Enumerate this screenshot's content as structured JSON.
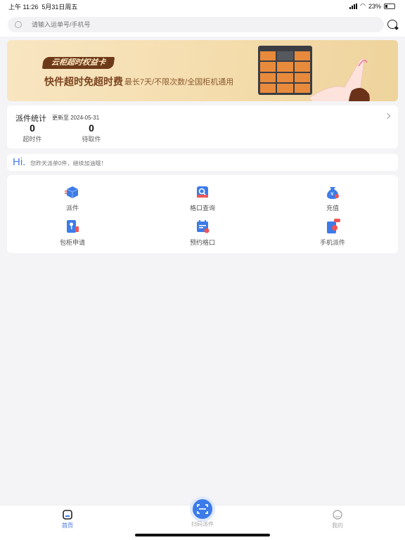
{
  "status_bar": {
    "time": "上午 11:26",
    "date": "5月31日周五",
    "battery": "23%"
  },
  "search": {
    "placeholder": "请输入运单号/手机号",
    "icon": "search-icon"
  },
  "header": {
    "message_icon": "chat-icon"
  },
  "banner": {
    "tag": "云柜超时权益卡",
    "title": "快件超时免超时费",
    "subtitle": "最长7天/不限次数/全国柜机通用"
  },
  "stats": {
    "title": "派件统计",
    "updated": "更新至 2024-05-31",
    "items": [
      {
        "value": "0",
        "label": "超时件"
      },
      {
        "value": "0",
        "label": "待取件"
      }
    ]
  },
  "greeting": {
    "hi": "Hi.",
    "text": "您昨天派单0件，继续加油哦！"
  },
  "features": [
    {
      "label": "派件",
      "icon": "box-icon"
    },
    {
      "label": "格口查询",
      "icon": "cabinet-search-icon"
    },
    {
      "label": "充值",
      "icon": "money-bag-icon"
    },
    {
      "label": "包柜申请",
      "icon": "key-icon"
    },
    {
      "label": "预约格口",
      "icon": "calendar-clock-icon"
    },
    {
      "label": "手机派件",
      "icon": "phone-icon"
    }
  ],
  "tabs": {
    "home": "首页",
    "scan": "扫码派件",
    "mine": "我的"
  },
  "colors": {
    "accent": "#3d7be8",
    "banner_brown": "#6d3a19"
  }
}
